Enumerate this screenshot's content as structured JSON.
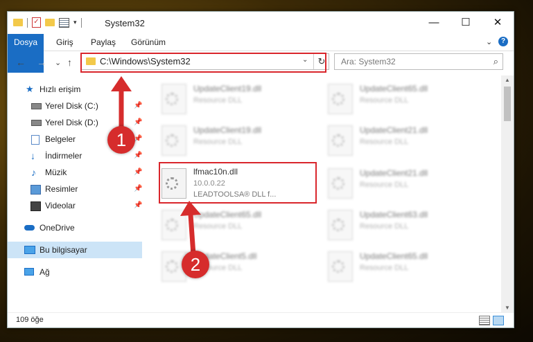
{
  "window": {
    "title": "System32",
    "qat_check": "✓",
    "qat_dropdown": "▾",
    "minimize": "—",
    "maximize": "☐",
    "close": "✕"
  },
  "ribbon": {
    "tabs": [
      "Dosya",
      "Giriş",
      "Paylaş",
      "Görünüm"
    ],
    "expand": "⌄",
    "help": "?"
  },
  "nav": {
    "back": "←",
    "forward": "→",
    "recent": "⌄",
    "up": "↑",
    "address": "C:\\Windows\\System32",
    "address_dropdown": "⌄",
    "refresh": "↻",
    "search_placeholder": "Ara: System32",
    "search_icon": "⌕"
  },
  "sidebar": {
    "items": [
      {
        "label": "Hızlı erişim",
        "icon": "star-icon",
        "pinned": false
      },
      {
        "label": "Yerel Disk (C:)",
        "icon": "drive-icon",
        "pinned": true
      },
      {
        "label": "Yerel Disk (D:)",
        "icon": "drive-icon",
        "pinned": true
      },
      {
        "label": "Belgeler",
        "icon": "documents-icon",
        "pinned": true
      },
      {
        "label": "İndirmeler",
        "icon": "downloads-icon",
        "pinned": true
      },
      {
        "label": "Müzik",
        "icon": "music-icon",
        "pinned": true
      },
      {
        "label": "Resimler",
        "icon": "pictures-icon",
        "pinned": true
      },
      {
        "label": "Videolar",
        "icon": "videos-icon",
        "pinned": true
      },
      {
        "label": "OneDrive",
        "icon": "cloud-icon",
        "pinned": false
      },
      {
        "label": "Bu bilgisayar",
        "icon": "computer-icon",
        "pinned": false
      },
      {
        "label": "Ağ",
        "icon": "network-icon",
        "pinned": false
      }
    ],
    "pin_glyph": "📌"
  },
  "files": [
    {
      "name": "UpdateClient19.dll",
      "type": "Resource DLL"
    },
    {
      "name": "UpdateClient65.dll",
      "type": "Resource DLL"
    },
    {
      "name": "UpdateClient19.dll",
      "type": "Resource DLL"
    },
    {
      "name": "UpdateClient21.dll",
      "type": "Resource DLL"
    },
    {
      "name": "lfmac10n.dll",
      "version": "10.0.0.22",
      "description": "LEADTOOLSA® DLL f..."
    },
    {
      "name": "UpdateClient21.dll",
      "type": "Resource DLL"
    },
    {
      "name": "UpdateClient65.dll",
      "type": "Resource DLL"
    },
    {
      "name": "UpdateClient63.dll",
      "type": "Resource DLL"
    },
    {
      "name": "UpdateClient5.dll",
      "type": "Resource DLL"
    },
    {
      "name": "UpdateClient65.dll",
      "type": "Resource DLL"
    }
  ],
  "status": {
    "count": "109 öğe"
  },
  "annotations": {
    "badge1": "1",
    "badge2": "2",
    "color": "#d9252b"
  }
}
